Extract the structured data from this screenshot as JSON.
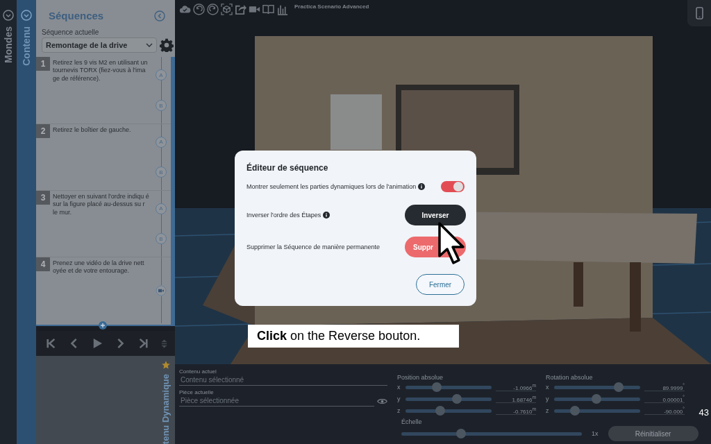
{
  "left_rail": {
    "label": "Mondes"
  },
  "content_rail": {
    "label": "Contenu"
  },
  "sequences_panel": {
    "title": "Séquences",
    "current_label": "Séquence actuelle",
    "current_value": "Remontage de la drive",
    "steps": [
      {
        "number": "1",
        "text": "Retirez les 9 vis M2 en utilisant un tournevis TORX (fiez-vous à l'ima ge de référence).",
        "markers": [
          {
            "kind": "letter",
            "label": "A"
          },
          {
            "kind": "letter",
            "label": "B"
          }
        ]
      },
      {
        "number": "2",
        "text": "Retirez le boîtier de gauche.",
        "markers": [
          {
            "kind": "letter",
            "label": "A"
          },
          {
            "kind": "letter",
            "label": "B"
          }
        ]
      },
      {
        "number": "3",
        "text": "Nettoyer en suivant l'ordre indiqu é sur la figure placé au-dessus su r le mur.",
        "markers": [
          {
            "kind": "letter",
            "label": "A"
          },
          {
            "kind": "letter",
            "label": "B"
          }
        ]
      },
      {
        "number": "4",
        "text": "Prenez une vidéo de la drive nett oyée et de votre entourage.",
        "markers": [
          {
            "kind": "video"
          }
        ]
      }
    ]
  },
  "dynamic_panel": {
    "label": "tenu Dynamique"
  },
  "toolbar": {
    "title": "Practica Scenario Advanced"
  },
  "dialog": {
    "title": "Éditeur de séquence",
    "rows": [
      {
        "kind": "toggle",
        "label": "Montrer seulement les parties dynamiques lors de l'animation",
        "info": true,
        "on": true
      },
      {
        "kind": "button",
        "label": "Inverser l'ordre des Étapes",
        "info": true,
        "button": "Inverser"
      },
      {
        "kind": "delete_button",
        "label": "Supprimer la Séquence de manière permanente",
        "button": "Suppr"
      }
    ],
    "close_button": "Fermer"
  },
  "caption": "**Click** on the Reverse bouton.",
  "properties": {
    "fields": [
      {
        "label": "Contenu actuel",
        "placeholder": "Contenu sélectionné"
      },
      {
        "label": "Pièce actuelle",
        "placeholder": "Pièce sélectionnée",
        "visibility": true
      }
    ],
    "position": {
      "title": "Position absolue",
      "axes": [
        {
          "axis": "x",
          "level": 0.36,
          "value": "-1.0966$^{m}$"
        },
        {
          "axis": "y",
          "level": 0.6,
          "value": "1.68746$^{m}$"
        },
        {
          "axis": "z",
          "level": 0.4,
          "value": "-0.7610$^{m}$"
        }
      ]
    },
    "rotation": {
      "title": "Rotation absolue",
      "axes": [
        {
          "axis": "x",
          "level": 0.75,
          "value": "89.9999$^{°}$"
        },
        {
          "axis": "y",
          "level": 0.49,
          "value": "0.00001$^{°}$"
        },
        {
          "axis": "z",
          "level": 0.24,
          "value": "-90.000$^{°}$"
        }
      ]
    },
    "scale": {
      "title": "Échelle",
      "level": 0.33,
      "value": "1x"
    },
    "reset_button": "Réinitialiser"
  },
  "page_number": "43"
}
